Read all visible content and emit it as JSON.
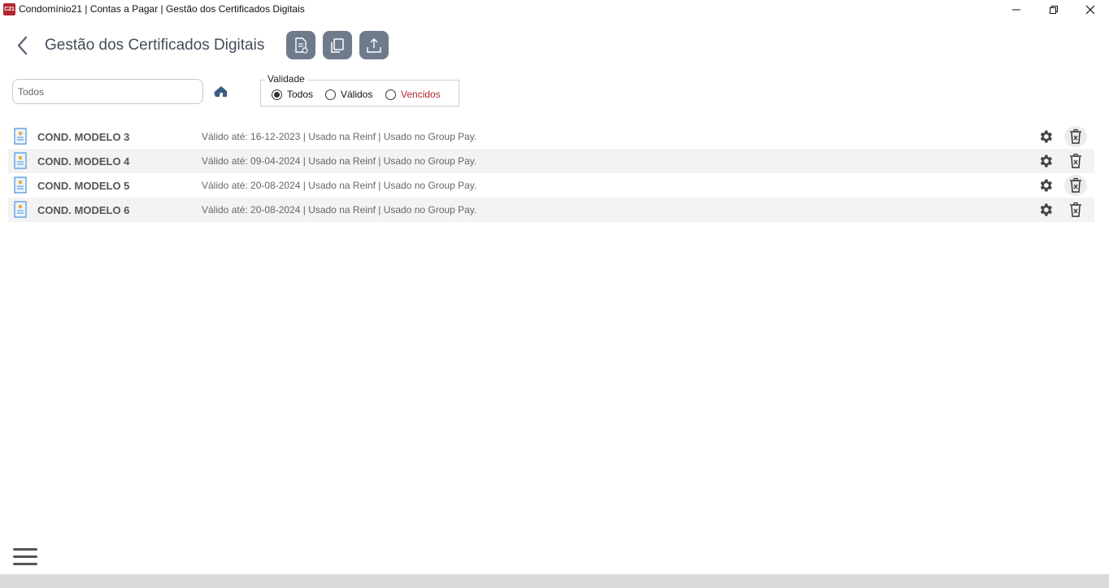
{
  "window": {
    "title": "Condomínio21 | Contas a Pagar | Gestão dos Certificados Digitais",
    "app_icon_text": "C21"
  },
  "header": {
    "title": "Gestão dos Certificados Digitais",
    "tools": [
      "new-document-icon",
      "copy-icon",
      "upload-icon"
    ]
  },
  "filter": {
    "search_placeholder": "Todos",
    "search_value": "",
    "validade": {
      "legend": "Validade",
      "options": [
        {
          "label": "Todos",
          "selected": true
        },
        {
          "label": "Válidos",
          "selected": false
        },
        {
          "label": "Vencidos",
          "selected": false
        }
      ]
    }
  },
  "certificates": [
    {
      "name": "COND. MODELO 3",
      "info": "Válido até: 16-12-2023 | Usado na Reinf | Usado no Group Pay."
    },
    {
      "name": "COND. MODELO 4",
      "info": "Válido até: 09-04-2024 | Usado na Reinf | Usado no Group Pay."
    },
    {
      "name": "COND. MODELO 5",
      "info": "Válido até: 20-08-2024 | Usado na Reinf | Usado no Group Pay."
    },
    {
      "name": "COND. MODELO 6",
      "info": "Válido até: 20-08-2024 | Usado na Reinf | Usado no Group Pay."
    }
  ],
  "colors": {
    "accent_red": "#b3262e",
    "tool_button": "#6f7b8b",
    "title_text": "#444c5c"
  }
}
